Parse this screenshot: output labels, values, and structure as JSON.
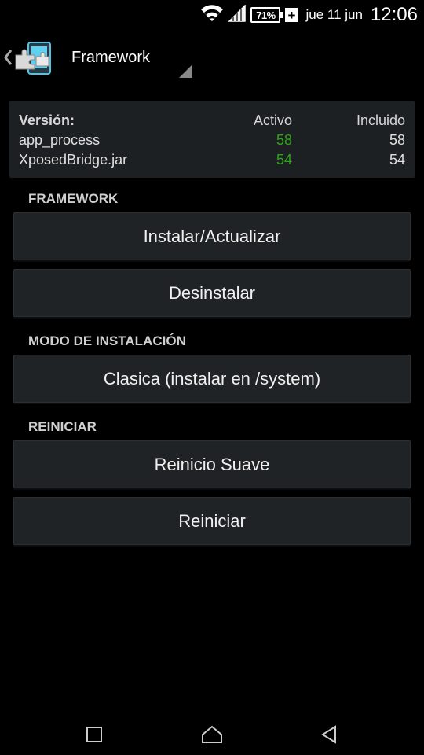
{
  "status_bar": {
    "battery_percent": "71%",
    "charge_symbol": "+",
    "date": "jue 11 jun",
    "time": "12:06",
    "icons": [
      "wifi-icon",
      "signal-icon",
      "battery-icon",
      "charging-icon"
    ]
  },
  "action_bar": {
    "title": "Framework",
    "icons": [
      "back-chevron-icon",
      "xposed-puzzle-icon",
      "dropdown-triangle-icon"
    ]
  },
  "version_table": {
    "headers": [
      "Versión:",
      "Activo",
      "Incluido"
    ],
    "rows": [
      [
        "app_process",
        "58",
        "58"
      ],
      [
        "XposedBridge.jar",
        "54",
        "54"
      ]
    ],
    "active_color": "#2ea51b"
  },
  "sections": {
    "framework": "FRAMEWORK",
    "install_mode": "MODO DE INSTALACIÓN",
    "reboot": "REINICIAR"
  },
  "buttons": {
    "install": "Instalar/Actualizar",
    "uninstall": "Desinstalar",
    "install_mode": "Clasica (instalar en /system)",
    "soft_reboot": "Reinicio Suave",
    "reboot": "Reiniciar"
  },
  "nav_bar": {
    "icons": [
      "recents-square-icon",
      "home-house-icon",
      "back-triangle-icon"
    ]
  }
}
